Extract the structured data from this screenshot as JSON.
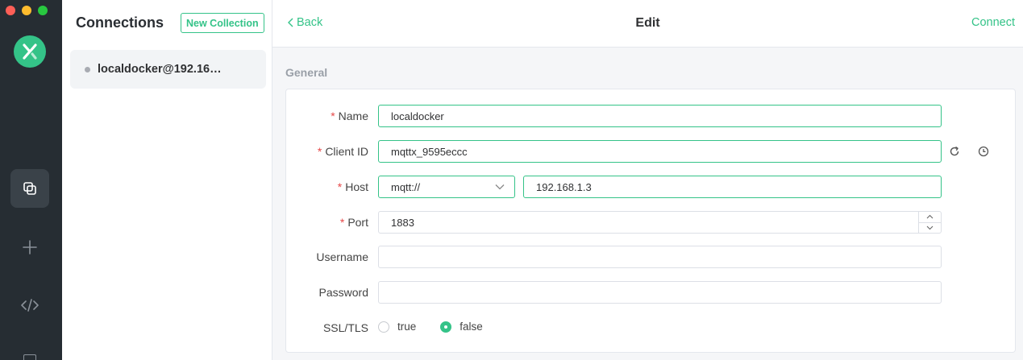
{
  "colors": {
    "accent": "#34c388",
    "rail": "#262d33",
    "required": "#e64848"
  },
  "window": {
    "controls": [
      "close",
      "minimize",
      "zoom"
    ]
  },
  "rail": {
    "items": [
      {
        "icon": "connections-icon",
        "active": true
      },
      {
        "icon": "plus-icon",
        "active": false
      },
      {
        "icon": "code-icon",
        "active": false
      }
    ]
  },
  "connections": {
    "title": "Connections",
    "new_collection_label": "New Collection",
    "items": [
      {
        "name": "localdocker@192.16…"
      }
    ]
  },
  "topbar": {
    "back_label": "Back",
    "title": "Edit",
    "connect_label": "Connect"
  },
  "general": {
    "section_label": "General",
    "name": {
      "label": "Name",
      "value": "localdocker"
    },
    "client_id": {
      "label": "Client ID",
      "value": "mqttx_9595eccc"
    },
    "host": {
      "label": "Host",
      "protocol": "mqtt://",
      "value": "192.168.1.3"
    },
    "port": {
      "label": "Port",
      "value": "1883"
    },
    "username": {
      "label": "Username",
      "value": ""
    },
    "password": {
      "label": "Password",
      "value": ""
    },
    "ssl_tls": {
      "label": "SSL/TLS",
      "options": [
        "true",
        "false"
      ],
      "selected": "false"
    }
  }
}
